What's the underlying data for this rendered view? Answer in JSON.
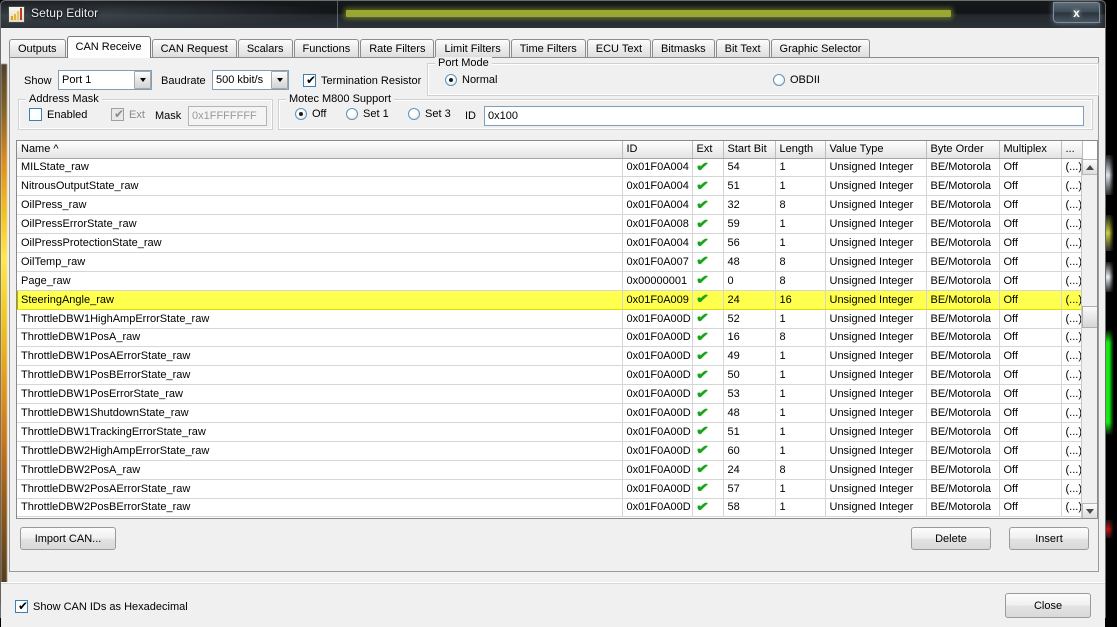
{
  "window": {
    "title": "Setup Editor",
    "close_glyph": "x",
    "icon": "app-bars-icon"
  },
  "tabs": [
    {
      "label": "Outputs",
      "active": false
    },
    {
      "label": "CAN Receive",
      "active": true
    },
    {
      "label": "CAN Request",
      "active": false
    },
    {
      "label": "Scalars",
      "active": false
    },
    {
      "label": "Functions",
      "active": false
    },
    {
      "label": "Rate Filters",
      "active": false
    },
    {
      "label": "Limit Filters",
      "active": false
    },
    {
      "label": "Time Filters",
      "active": false
    },
    {
      "label": "ECU Text",
      "active": false
    },
    {
      "label": "Bitmasks",
      "active": false
    },
    {
      "label": "Bit Text",
      "active": false
    },
    {
      "label": "Graphic Selector",
      "active": false
    }
  ],
  "controls": {
    "show_label": "Show",
    "show_value": "Port 1",
    "baudrate_label": "Baudrate",
    "baudrate_value": "500 kbit/s",
    "termination_resistor_label": "Termination Resistor",
    "termination_resistor_checked": true,
    "port_mode": {
      "title": "Port Mode",
      "options": [
        {
          "label": "Normal",
          "selected": true
        },
        {
          "label": "OBDII",
          "selected": false
        }
      ]
    },
    "address_mask": {
      "title": "Address Mask",
      "enabled_label": "Enabled",
      "enabled_checked": false,
      "ext_label": "Ext",
      "ext_checked": true,
      "ext_disabled": true,
      "mask_label": "Mask",
      "mask_value": "0x1FFFFFFF"
    },
    "motec": {
      "title": "Motec M800 Support",
      "options": [
        {
          "label": "Off",
          "selected": true
        },
        {
          "label": "Set 1",
          "selected": false
        },
        {
          "label": "Set 3",
          "selected": false
        }
      ],
      "id_label": "ID",
      "id_value": "0x100"
    }
  },
  "table": {
    "columns": [
      {
        "key": "name",
        "label": "Name ^"
      },
      {
        "key": "id",
        "label": "ID"
      },
      {
        "key": "ext",
        "label": "Ext"
      },
      {
        "key": "start_bit",
        "label": "Start Bit"
      },
      {
        "key": "length",
        "label": "Length"
      },
      {
        "key": "value_type",
        "label": "Value Type"
      },
      {
        "key": "byte_order",
        "label": "Byte Order"
      },
      {
        "key": "multiplex",
        "label": "Multiplex"
      },
      {
        "key": "more",
        "label": "..."
      }
    ],
    "sort_column": "Name",
    "sort_direction": "ascending",
    "ext_glyph": "✔",
    "more_cell": "(...)",
    "rows": [
      {
        "name": "MILState_raw",
        "id": "0x01F0A004",
        "ext": true,
        "start_bit": "54",
        "length": "1",
        "value_type": "Unsigned Integer",
        "byte_order": "BE/Motorola",
        "multiplex": "Off",
        "more": "(...)",
        "selected": false
      },
      {
        "name": "NitrousOutputState_raw",
        "id": "0x01F0A004",
        "ext": true,
        "start_bit": "51",
        "length": "1",
        "value_type": "Unsigned Integer",
        "byte_order": "BE/Motorola",
        "multiplex": "Off",
        "more": "(...)",
        "selected": false
      },
      {
        "name": "OilPress_raw",
        "id": "0x01F0A004",
        "ext": true,
        "start_bit": "32",
        "length": "8",
        "value_type": "Unsigned Integer",
        "byte_order": "BE/Motorola",
        "multiplex": "Off",
        "more": "(...)",
        "selected": false
      },
      {
        "name": "OilPressErrorState_raw",
        "id": "0x01F0A008",
        "ext": true,
        "start_bit": "59",
        "length": "1",
        "value_type": "Unsigned Integer",
        "byte_order": "BE/Motorola",
        "multiplex": "Off",
        "more": "(...)",
        "selected": false
      },
      {
        "name": "OilPressProtectionState_raw",
        "id": "0x01F0A004",
        "ext": true,
        "start_bit": "56",
        "length": "1",
        "value_type": "Unsigned Integer",
        "byte_order": "BE/Motorola",
        "multiplex": "Off",
        "more": "(...)",
        "selected": false
      },
      {
        "name": "OilTemp_raw",
        "id": "0x01F0A007",
        "ext": true,
        "start_bit": "48",
        "length": "8",
        "value_type": "Unsigned Integer",
        "byte_order": "BE/Motorola",
        "multiplex": "Off",
        "more": "(...)",
        "selected": false
      },
      {
        "name": "Page_raw",
        "id": "0x00000001",
        "ext": true,
        "start_bit": "0",
        "length": "8",
        "value_type": "Unsigned Integer",
        "byte_order": "BE/Motorola",
        "multiplex": "Off",
        "more": "(...)",
        "selected": false
      },
      {
        "name": "SteeringAngle_raw",
        "id": "0x01F0A009",
        "ext": true,
        "start_bit": "24",
        "length": "16",
        "value_type": "Unsigned Integer",
        "byte_order": "BE/Motorola",
        "multiplex": "Off",
        "more": "(...)",
        "selected": true
      },
      {
        "name": "ThrottleDBW1HighAmpErrorState_raw",
        "id": "0x01F0A00D",
        "ext": true,
        "start_bit": "52",
        "length": "1",
        "value_type": "Unsigned Integer",
        "byte_order": "BE/Motorola",
        "multiplex": "Off",
        "more": "(...)",
        "selected": false
      },
      {
        "name": "ThrottleDBW1PosA_raw",
        "id": "0x01F0A00D",
        "ext": true,
        "start_bit": "16",
        "length": "8",
        "value_type": "Unsigned Integer",
        "byte_order": "BE/Motorola",
        "multiplex": "Off",
        "more": "(...)",
        "selected": false
      },
      {
        "name": "ThrottleDBW1PosAErrorState_raw",
        "id": "0x01F0A00D",
        "ext": true,
        "start_bit": "49",
        "length": "1",
        "value_type": "Unsigned Integer",
        "byte_order": "BE/Motorola",
        "multiplex": "Off",
        "more": "(...)",
        "selected": false
      },
      {
        "name": "ThrottleDBW1PosBErrorState_raw",
        "id": "0x01F0A00D",
        "ext": true,
        "start_bit": "50",
        "length": "1",
        "value_type": "Unsigned Integer",
        "byte_order": "BE/Motorola",
        "multiplex": "Off",
        "more": "(...)",
        "selected": false
      },
      {
        "name": "ThrottleDBW1PosErrorState_raw",
        "id": "0x01F0A00D",
        "ext": true,
        "start_bit": "53",
        "length": "1",
        "value_type": "Unsigned Integer",
        "byte_order": "BE/Motorola",
        "multiplex": "Off",
        "more": "(...)",
        "selected": false
      },
      {
        "name": "ThrottleDBW1ShutdownState_raw",
        "id": "0x01F0A00D",
        "ext": true,
        "start_bit": "48",
        "length": "1",
        "value_type": "Unsigned Integer",
        "byte_order": "BE/Motorola",
        "multiplex": "Off",
        "more": "(...)",
        "selected": false
      },
      {
        "name": "ThrottleDBW1TrackingErrorState_raw",
        "id": "0x01F0A00D",
        "ext": true,
        "start_bit": "51",
        "length": "1",
        "value_type": "Unsigned Integer",
        "byte_order": "BE/Motorola",
        "multiplex": "Off",
        "more": "(...)",
        "selected": false
      },
      {
        "name": "ThrottleDBW2HighAmpErrorState_raw",
        "id": "0x01F0A00D",
        "ext": true,
        "start_bit": "60",
        "length": "1",
        "value_type": "Unsigned Integer",
        "byte_order": "BE/Motorola",
        "multiplex": "Off",
        "more": "(...)",
        "selected": false
      },
      {
        "name": "ThrottleDBW2PosA_raw",
        "id": "0x01F0A00D",
        "ext": true,
        "start_bit": "24",
        "length": "8",
        "value_type": "Unsigned Integer",
        "byte_order": "BE/Motorola",
        "multiplex": "Off",
        "more": "(...)",
        "selected": false
      },
      {
        "name": "ThrottleDBW2PosAErrorState_raw",
        "id": "0x01F0A00D",
        "ext": true,
        "start_bit": "57",
        "length": "1",
        "value_type": "Unsigned Integer",
        "byte_order": "BE/Motorola",
        "multiplex": "Off",
        "more": "(...)",
        "selected": false
      },
      {
        "name": "ThrottleDBW2PosBErrorState_raw",
        "id": "0x01F0A00D",
        "ext": true,
        "start_bit": "58",
        "length": "1",
        "value_type": "Unsigned Integer",
        "byte_order": "BE/Motorola",
        "multiplex": "Off",
        "more": "(...)",
        "selected": false
      }
    ]
  },
  "buttons": {
    "import_can": "Import CAN...",
    "delete": "Delete",
    "insert": "Insert",
    "close": "Close"
  },
  "footer": {
    "show_hex_label": "Show CAN IDs as Hexadecimal",
    "show_hex_checked": true
  },
  "colors": {
    "selection_yellow": "#ffff4d",
    "check_green": "#17a317",
    "dialog_face": "#f0f0f0",
    "field_border": "#7f9db9"
  }
}
